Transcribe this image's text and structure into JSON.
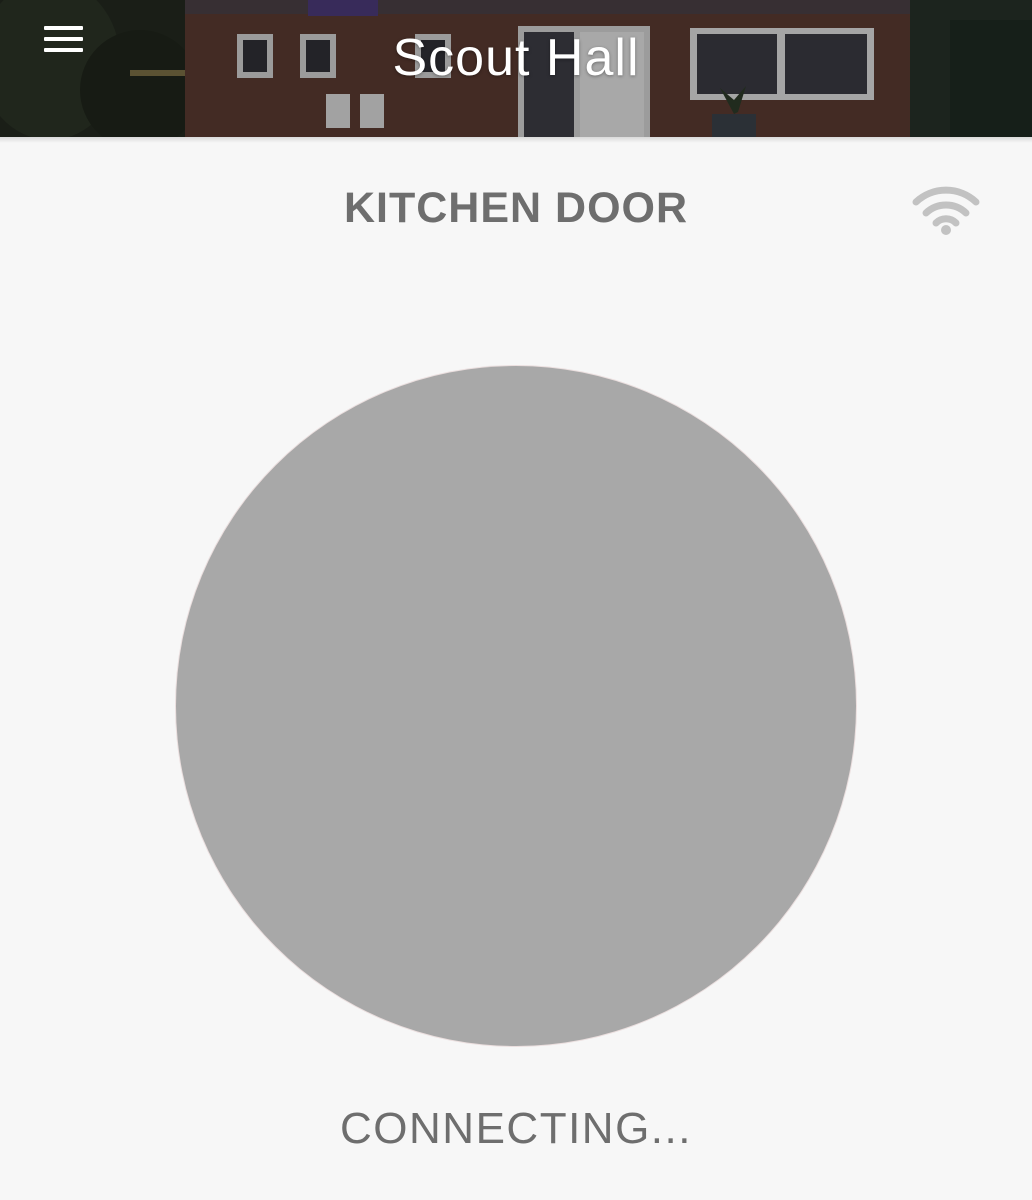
{
  "header": {
    "title": "Scout Hall",
    "menu_icon": "hamburger-menu-icon",
    "background_image": "scout-hall-building-photo"
  },
  "door": {
    "name": "KITCHEN DOOR",
    "signal_icon": "wifi-icon",
    "signal_color": "#c2c2c2"
  },
  "lock": {
    "button_color": "#a8a8a8",
    "status": "CONNECTING..."
  },
  "colors": {
    "background": "#f7f7f7",
    "text": "#6e6e6e",
    "header_text": "#ffffff"
  }
}
